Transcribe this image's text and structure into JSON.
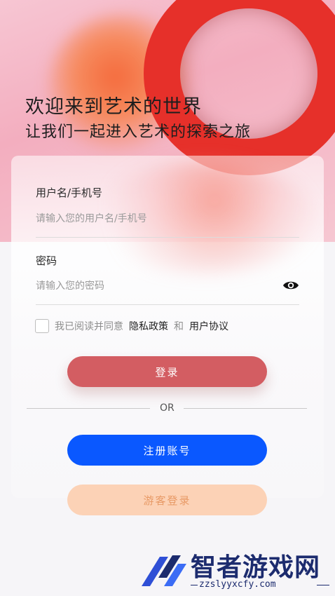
{
  "hero": {
    "title": "欢迎来到艺术的世界",
    "subtitle": "让我们一起进入艺术的探索之旅"
  },
  "form": {
    "username_label": "用户名/手机号",
    "username_placeholder": "请输入您的用户名/手机号",
    "password_label": "密码",
    "password_placeholder": "请输入您的密码",
    "password_toggle_icon": "eye-icon"
  },
  "agreement": {
    "prefix": "我已阅读并同意",
    "privacy_link": "隐私政策",
    "conjunction": "和",
    "terms_link": "用户协议",
    "checked": false
  },
  "buttons": {
    "login": "登录",
    "or": "OR",
    "register": "注册账号",
    "guest": "游客登录"
  },
  "watermark": {
    "name": "智者游戏网",
    "url": "zzslyyxcfy.com"
  },
  "colors": {
    "login_button": "#d35d62",
    "register_button": "#0a58ff",
    "guest_button": "#fcd2b6",
    "ring": "#e6302a"
  }
}
